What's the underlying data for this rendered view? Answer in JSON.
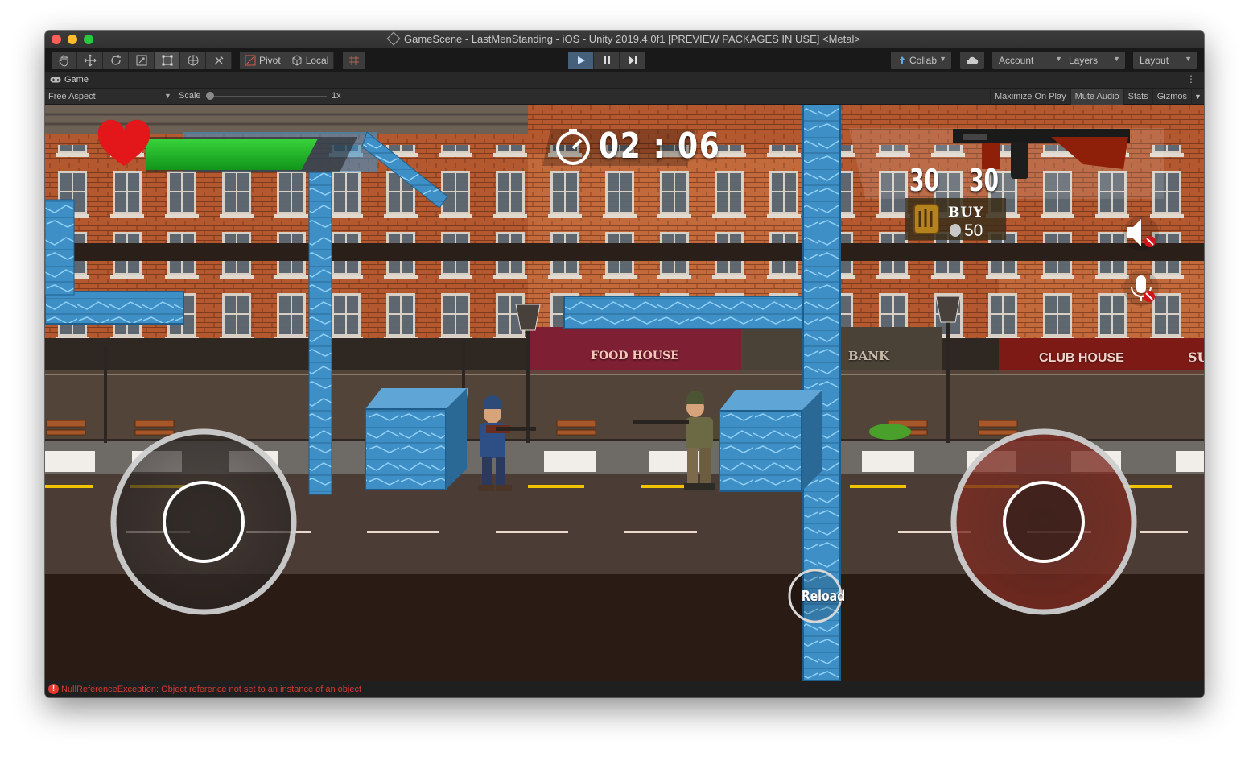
{
  "window": {
    "title": "GameScene - LastMenStanding - iOS - Unity 2019.4.0f1 [PREVIEW PACKAGES IN USE] <Metal>"
  },
  "toolbar": {
    "tools": [
      "hand-tool-icon",
      "move-tool-icon",
      "rotate-tool-icon",
      "scale-tool-icon",
      "rect-tool-icon",
      "transform-tool-icon",
      "custom-tool-icon"
    ],
    "pivot_label": "Pivot",
    "local_label": "Local",
    "collab_label": "Collab",
    "account_label": "Account",
    "layers_label": "Layers",
    "layout_label": "Layout"
  },
  "tab": {
    "label": "Game"
  },
  "game_bar": {
    "aspect": "Free Aspect",
    "scale_label": "Scale",
    "scale_value": "1x",
    "maximize_on_play": "Maximize On Play",
    "mute_audio": "Mute Audio",
    "stats": "Stats",
    "gizmos": "Gizmos"
  },
  "hud": {
    "timer": "02 : 06",
    "ammo_clip": "30",
    "ammo_total": "30",
    "buy_label": "BUY",
    "buy_price": "50",
    "reload_label": "Reload",
    "health_fraction": 0.85
  },
  "scene": {
    "signs": [
      "FOOD HOUSE",
      "BANK",
      "CLUB HOUSE",
      "SU"
    ]
  },
  "console": {
    "error_message": "NullReferenceException: Object reference not set to an instance of an object"
  },
  "colors": {
    "play_active": "#46607c",
    "health": "#1bb524",
    "heart": "#e3161a",
    "error": "#d33b32"
  }
}
